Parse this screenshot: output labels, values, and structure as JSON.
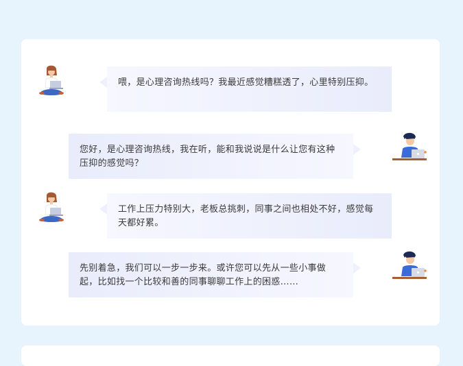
{
  "conversation": {
    "messages": [
      {
        "role": "user",
        "text": "喂，是心理咨询热线吗？我最近感觉糟糕透了，心里特别压抑。"
      },
      {
        "role": "counselor",
        "text": "您好，是心理咨询热线，我在听，能和我说说是什么让您有这种压抑的感觉吗？"
      },
      {
        "role": "user",
        "text": "工作上压力特别大，老板总挑刺，同事之间也相处不好，感觉每天都好累。"
      },
      {
        "role": "counselor",
        "text": "先别着急，我们可以一步一步来。或许您可以先从一些小事做起，比如找一个比较和善的同事聊聊工作上的困惑……"
      }
    ]
  },
  "avatars": {
    "user_icon": "woman-with-laptop-icon",
    "counselor_icon": "man-at-desk-with-laptop-icon"
  },
  "colors": {
    "page_background": "#e8f4fd",
    "card_background": "#ffffff",
    "bubble_light": "#f6f7ff",
    "bubble_dark": "#e9ecfb",
    "text": "#3a3a3a"
  }
}
